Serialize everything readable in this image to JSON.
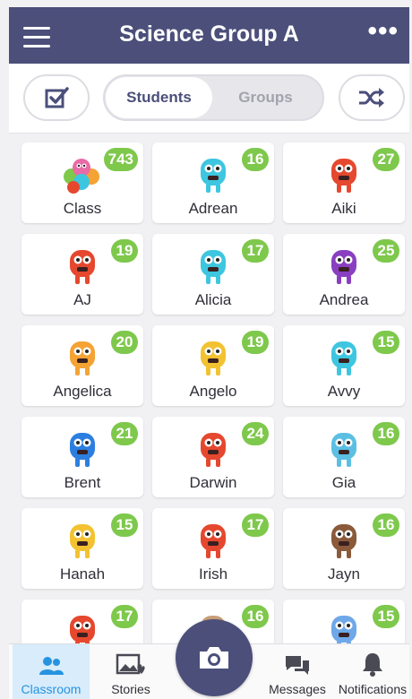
{
  "header": {
    "title": "Science Group A",
    "more": "•••"
  },
  "controls": {
    "students_label": "Students",
    "groups_label": "Groups"
  },
  "students": [
    {
      "name": "Class",
      "points": "743",
      "avatar": "class-group-icon",
      "color": "#f08a3e"
    },
    {
      "name": "Adrean",
      "points": "16",
      "avatar": "monster-avatar-icon",
      "color": "#3ec6e0"
    },
    {
      "name": "Aiki",
      "points": "27",
      "avatar": "monster-avatar-icon",
      "color": "#e5482e"
    },
    {
      "name": "AJ",
      "points": "19",
      "avatar": "monster-avatar-icon",
      "color": "#e5482e"
    },
    {
      "name": "Alicia",
      "points": "17",
      "avatar": "monster-avatar-icon",
      "color": "#3ec6e0"
    },
    {
      "name": "Andrea",
      "points": "25",
      "avatar": "monster-avatar-icon",
      "color": "#8a3fc0"
    },
    {
      "name": "Angelica",
      "points": "20",
      "avatar": "monster-avatar-icon",
      "color": "#f4a334"
    },
    {
      "name": "Angelo",
      "points": "19",
      "avatar": "monster-avatar-icon",
      "color": "#f2c230"
    },
    {
      "name": "Avvy",
      "points": "15",
      "avatar": "monster-avatar-icon",
      "color": "#3ec6e0"
    },
    {
      "name": "Brent",
      "points": "21",
      "avatar": "monster-avatar-icon",
      "color": "#2c7fe0"
    },
    {
      "name": "Darwin",
      "points": "24",
      "avatar": "monster-avatar-icon",
      "color": "#e5482e"
    },
    {
      "name": "Gia",
      "points": "16",
      "avatar": "monster-avatar-icon",
      "color": "#5bbfe4"
    },
    {
      "name": "Hanah",
      "points": "15",
      "avatar": "monster-avatar-icon",
      "color": "#f2c230"
    },
    {
      "name": "Irish",
      "points": "17",
      "avatar": "monster-avatar-icon",
      "color": "#e5482e"
    },
    {
      "name": "Jayn",
      "points": "16",
      "avatar": "monster-avatar-icon",
      "color": "#8a5a3a"
    },
    {
      "name": "",
      "points": "17",
      "avatar": "monster-avatar-icon",
      "color": "#e5482e"
    },
    {
      "name": "",
      "points": "16",
      "avatar": "monster-avatar-icon",
      "color": "#c9a07a"
    },
    {
      "name": "",
      "points": "15",
      "avatar": "monster-avatar-icon",
      "color": "#6ea8e8"
    }
  ],
  "bottom_nav": [
    {
      "label": "Classroom",
      "icon": "people-icon",
      "active": true
    },
    {
      "label": "Stories",
      "icon": "stories-icon",
      "active": false
    },
    {
      "label": "Messages",
      "icon": "chat-icon",
      "active": false
    },
    {
      "label": "Notifications",
      "icon": "bell-icon",
      "active": false
    }
  ],
  "colors": {
    "header": "#4b4f7a",
    "badge": "#7ec84c",
    "active_tab": "#2693e0"
  }
}
